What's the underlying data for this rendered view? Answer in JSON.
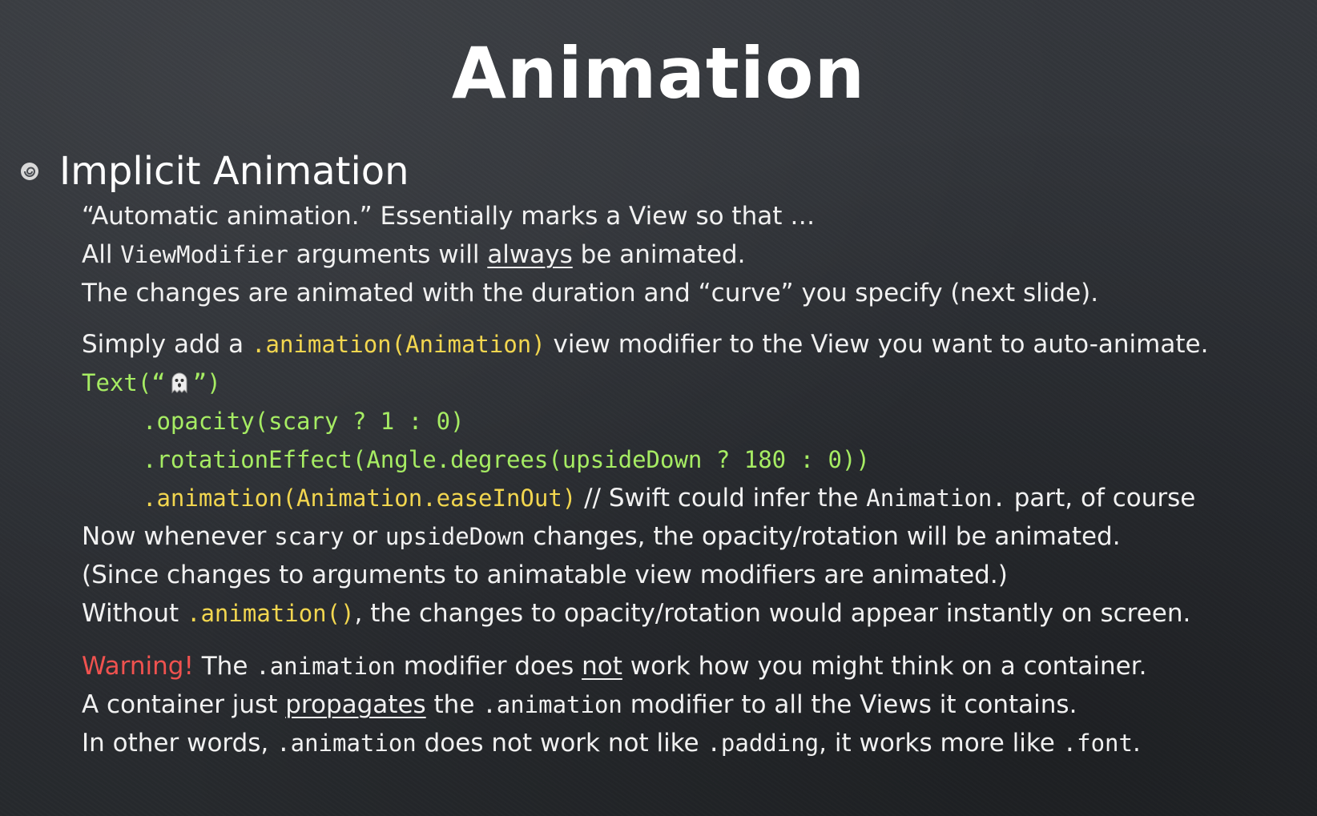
{
  "slide": {
    "title": "Animation",
    "heading": "Implicit Animation",
    "line1": "“Automatic animation.”  Essentially marks a View so that …",
    "line2_a": "All ",
    "line2_b": "ViewModifier",
    "line2_c": " arguments will ",
    "line2_d": "always",
    "line2_e": " be animated.",
    "line3": "The changes are animated with the duration and “curve” you specify (next slide).",
    "line4_a": "Simply add a ",
    "line4_b": ".animation(Animation)",
    "line4_c": " view modifier to the View you want to auto-animate.",
    "code1_a": "Text(“",
    "code1_b": "”)",
    "code2": ".opacity(scary ? 1 : 0)",
    "code3": ".rotationEffect(Angle.degrees(upsideDown ? 180 : 0))",
    "code4_a": ".animation(Animation.easeInOut)",
    "code4_b": " // Swift could infer the ",
    "code4_c": "Animation.",
    "code4_d": " part, of course",
    "line9_a": "Now whenever ",
    "line9_b": "scary",
    "line9_c": " or ",
    "line9_d": "upsideDown",
    "line9_e": " changes, the opacity/rotation will be animated.",
    "line10": "(Since changes to arguments to animatable view modifiers are animated.)",
    "line11_a": "Without ",
    "line11_b": ".animation()",
    "line11_c": ", the changes to opacity/rotation would appear instantly on screen.",
    "warn_label": "Warning!",
    "warn_a": "  The ",
    "warn_b": ".animation",
    "warn_c": " modifier does ",
    "warn_d": "not",
    "warn_e": " work how you might think on a container.",
    "line13_a": "A container just ",
    "line13_b": "propagates",
    "line13_c": " the ",
    "line13_d": ".animation",
    "line13_e": " modifier to all the Views it contains.",
    "line14_a": "In other words, ",
    "line14_b": ".animation",
    "line14_c": " does not work not like ",
    "line14_d": ".padding",
    "line14_e": ", it works more like ",
    "line14_f": ".font",
    "line14_g": "."
  },
  "icons": {
    "bullet": "spiral-bullet-icon",
    "ghost": "ghost-emoji-icon"
  },
  "colors": {
    "background": "#2d3035",
    "text": "#f1f1f1",
    "code_yellow": "#f2d64f",
    "code_green": "#a6ec63",
    "warning": "#f0524f"
  }
}
